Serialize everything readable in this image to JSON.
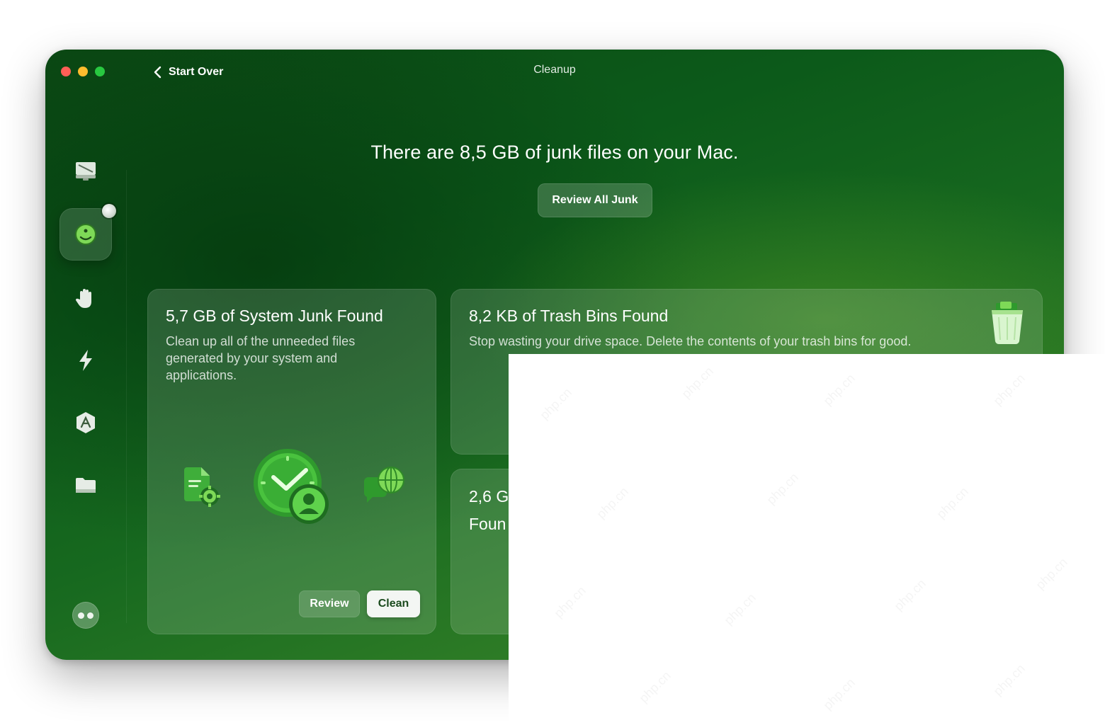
{
  "window": {
    "title": "Cleanup",
    "back_label": "Start Over"
  },
  "sidebar": {
    "items": [
      {
        "name": "monitor-icon"
      },
      {
        "name": "cleanup-icon",
        "active": true,
        "has_badge": true
      },
      {
        "name": "hand-icon"
      },
      {
        "name": "lightning-icon"
      },
      {
        "name": "applications-icon"
      },
      {
        "name": "folder-icon"
      }
    ],
    "profile_icon": "assistant-icon"
  },
  "main": {
    "headline": "There are 8,5 GB of junk files on your Mac.",
    "review_all_label": "Review All Junk"
  },
  "cards": {
    "system_junk": {
      "title": "5,7 GB of System Junk Found",
      "description": "Clean up all of the unneeded files generated by your system and applications.",
      "review_label": "Review",
      "clean_label": "Clean",
      "icons": [
        "document-gear-icon",
        "clock-user-icon",
        "globe-chat-icon"
      ]
    },
    "trash_bins": {
      "title": "8,2 KB of Trash Bins Found",
      "description": "Stop wasting your drive space. Delete the contents of your trash bins for good.",
      "icon": "trash-bin-icon"
    },
    "third": {
      "title_line1": "2,6 G",
      "title_line2": "Foun"
    }
  },
  "overlay": {
    "watermark": "php.cn"
  },
  "colors": {
    "window_bg_dark": "#0b4a14",
    "window_bg_light": "#3f8a2a",
    "clean_button_bg": "#f3f6f3",
    "clean_button_text": "#1a4a1d",
    "traffic_red": "#ff5f57",
    "traffic_yellow": "#febc2e",
    "traffic_green": "#28c840"
  }
}
